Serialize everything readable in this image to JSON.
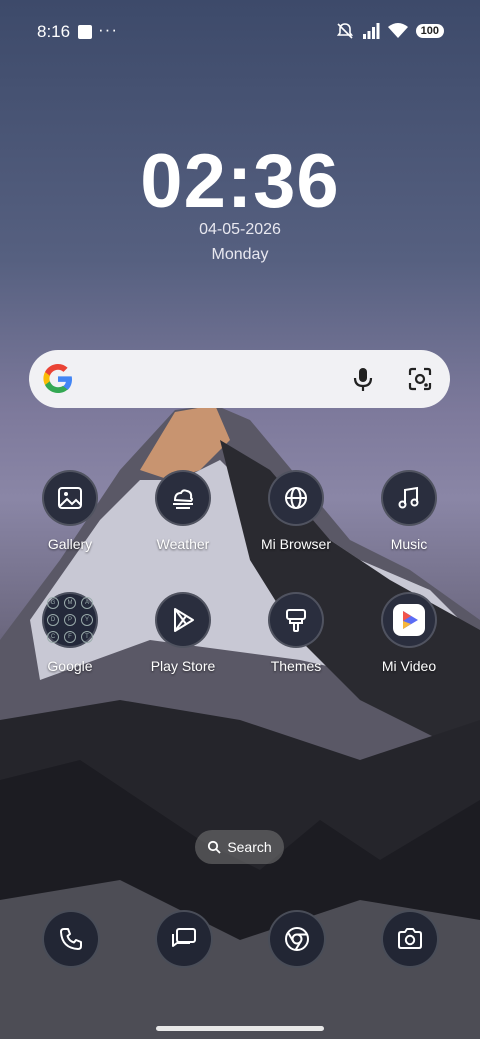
{
  "status_bar": {
    "time": "8:16",
    "dots": "···",
    "battery": "100"
  },
  "clock": {
    "time": "02:36",
    "date": "04-05-2026",
    "day": "Monday"
  },
  "apps": [
    {
      "label": "Gallery",
      "icon": "gallery-icon"
    },
    {
      "label": "Weather",
      "icon": "weather-icon"
    },
    {
      "label": "Mi Browser",
      "icon": "globe-icon"
    },
    {
      "label": "Music",
      "icon": "music-icon"
    },
    {
      "label": "Google",
      "icon": "folder-icon"
    },
    {
      "label": "Play Store",
      "icon": "play-store-icon"
    },
    {
      "label": "Themes",
      "icon": "themes-icon"
    },
    {
      "label": "Mi Video",
      "icon": "mi-video-icon"
    }
  ],
  "page_search": {
    "label": "Search"
  },
  "dock": [
    {
      "icon": "phone-icon"
    },
    {
      "icon": "messages-icon"
    },
    {
      "icon": "chrome-icon"
    },
    {
      "icon": "camera-icon"
    }
  ],
  "colors": {
    "icon_bg": "#2a2e3e",
    "search_bar_bg": "#f1f1f4"
  }
}
